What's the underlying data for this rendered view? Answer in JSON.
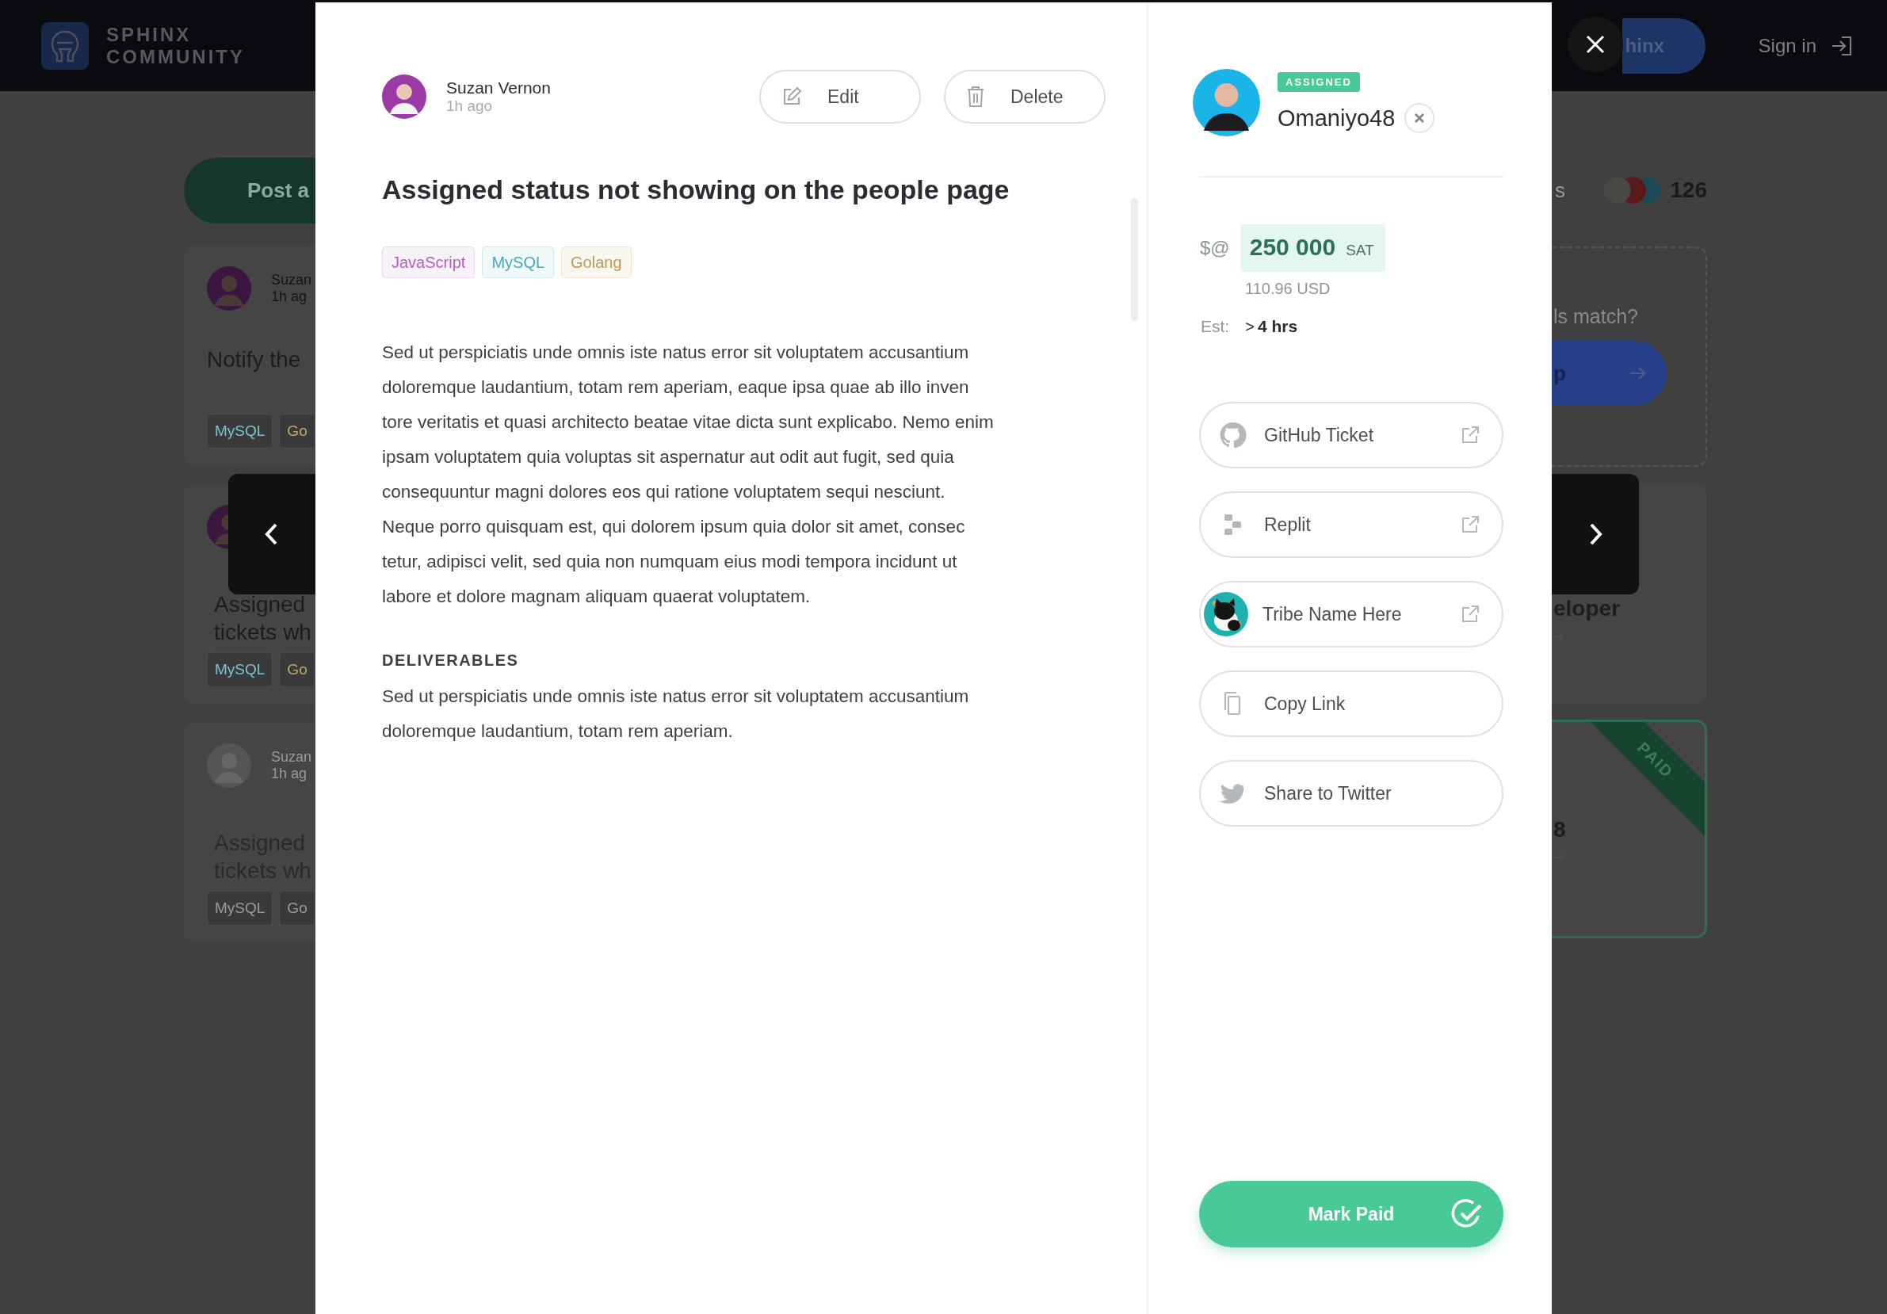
{
  "header": {
    "logo_lines": [
      "SPHINX",
      "COMMUNITY"
    ],
    "get_button": "hinx",
    "sign_in": "Sign in"
  },
  "left_column": {
    "post_button": "Post a",
    "cards": [
      {
        "author": "Suzan",
        "time": "1h ag",
        "title": [
          "Notify the"
        ],
        "tags": [
          {
            "label": "MySQL",
            "color": "#7cc3cb"
          },
          {
            "label": "Go",
            "color": "#c4a76a"
          }
        ],
        "faded": false
      },
      {
        "title": [
          "Assigned",
          "tickets wh"
        ],
        "tags": [
          {
            "label": "MySQL",
            "color": "#7cc3cb"
          },
          {
            "label": "Go",
            "color": "#c4a76a"
          }
        ],
        "faded": false
      },
      {
        "author": "Suzan",
        "time": "1h ag",
        "title": [
          "Assigned",
          "tickets wh"
        ],
        "tags": [
          {
            "label": "MySQL",
            "color": "#9a9a9a"
          },
          {
            "label": "Go",
            "color": "#9a9a9a"
          }
        ],
        "faded": true
      }
    ]
  },
  "right_column": {
    "stats": {
      "label": "s",
      "count": "126"
    },
    "prompt": {
      "text": "ls match?",
      "button": "p"
    },
    "cards": [
      {
        "title": "eloper",
        "paid": false
      },
      {
        "title": "8",
        "paid": true,
        "ribbon": "PAID"
      }
    ]
  },
  "modal": {
    "author": "Suzan Vernon",
    "time": "1h ago",
    "edit": "Edit",
    "delete": "Delete",
    "title": "Assigned status not showing on the people page",
    "tags": [
      {
        "label": "JavaScript",
        "color": "#b75cc8"
      },
      {
        "label": "MySQL",
        "color": "#49a9b8"
      },
      {
        "label": "Golang",
        "color": "#c0994f"
      }
    ],
    "description": [
      "Sed ut perspiciatis unde omnis iste natus error sit voluptatem accusantium",
      "doloremque laudantium, totam rem aperiam, eaque ipsa quae ab illo inven",
      "tore veritatis et quasi architecto beatae vitae dicta sunt explicabo. Nemo enim",
      "ipsam voluptatem quia voluptas sit aspernatur aut odit aut fugit, sed quia",
      "consequuntur magni dolores eos qui ratione voluptatem sequi nesciunt.",
      "Neque porro quisquam est, qui dolorem ipsum quia dolor sit amet, consec",
      "tetur, adipisci velit, sed quia non numquam eius modi tempora incidunt ut",
      "labore et dolore magnam aliquam quaerat voluptatem."
    ],
    "deliverables_heading": "DELIVERABLES",
    "deliverables": [
      "Sed ut perspiciatis unde omnis iste natus error sit voluptatem accusantium",
      "doloremque laudantium, totam rem aperiam."
    ],
    "assignee": {
      "status": "ASSIGNED",
      "name": "Omaniyo48"
    },
    "price": {
      "prefix": "$@",
      "amount": "250 000",
      "unit": "SAT",
      "usd": "110.96 USD"
    },
    "estimate": {
      "label": "Est:",
      "prefix": ">",
      "value": "4 hrs"
    },
    "links": [
      {
        "kind": "github",
        "label": "GitHub Ticket",
        "external": true
      },
      {
        "kind": "replit",
        "label": "Replit",
        "external": true
      },
      {
        "kind": "tribe",
        "label": "Tribe Name Here",
        "external": true
      },
      {
        "kind": "copy",
        "label": "Copy Link",
        "external": false
      },
      {
        "kind": "twitter",
        "label": "Share to Twitter",
        "external": false
      }
    ],
    "mark_paid": "Mark Paid"
  }
}
